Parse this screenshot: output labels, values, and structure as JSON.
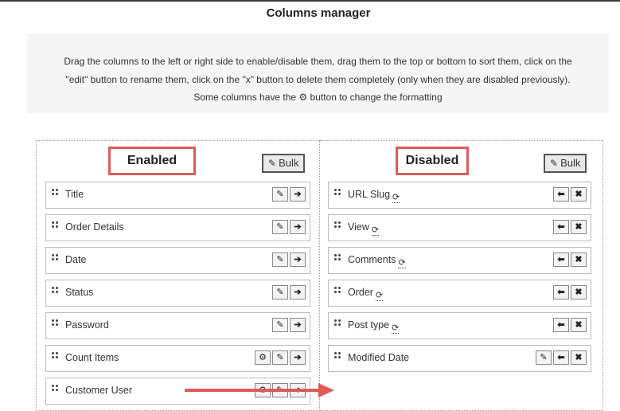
{
  "page_title": "Columns manager",
  "help": {
    "line1": "Drag the columns to the left or right side to enable/disable them, drag them to the top or bottom to sort them, click on the",
    "line2": "\"edit\" button to rename them, click on the \"x\" button to delete them completely (only when they are disabled previously).",
    "line3_prefix": "Some columns have the",
    "line3_suffix": "button to change the formatting"
  },
  "enabled": {
    "header": "Enabled",
    "bulk_label": "Bulk",
    "items": [
      {
        "label": "Title"
      },
      {
        "label": "Order Details"
      },
      {
        "label": "Date"
      },
      {
        "label": "Status"
      },
      {
        "label": "Password"
      },
      {
        "label": "Count Items"
      },
      {
        "label": "Customer User"
      }
    ]
  },
  "disabled": {
    "header": "Disabled",
    "bulk_label": "Bulk",
    "items": [
      {
        "label": "URL Slug"
      },
      {
        "label": "View"
      },
      {
        "label": "Comments"
      },
      {
        "label": "Order"
      },
      {
        "label": "Post type"
      },
      {
        "label": "Modified Date"
      }
    ]
  },
  "icons": {
    "edit": "edit-icon",
    "arrow_right": "arrow-right-icon",
    "arrow_left": "arrow-left-icon",
    "close": "close-icon",
    "gear": "gear-icon",
    "sync": "sync-icon",
    "drag": "drag-handle-icon"
  },
  "colors": {
    "highlight": "#e05a5a",
    "help_bg": "#f5f5f5"
  }
}
